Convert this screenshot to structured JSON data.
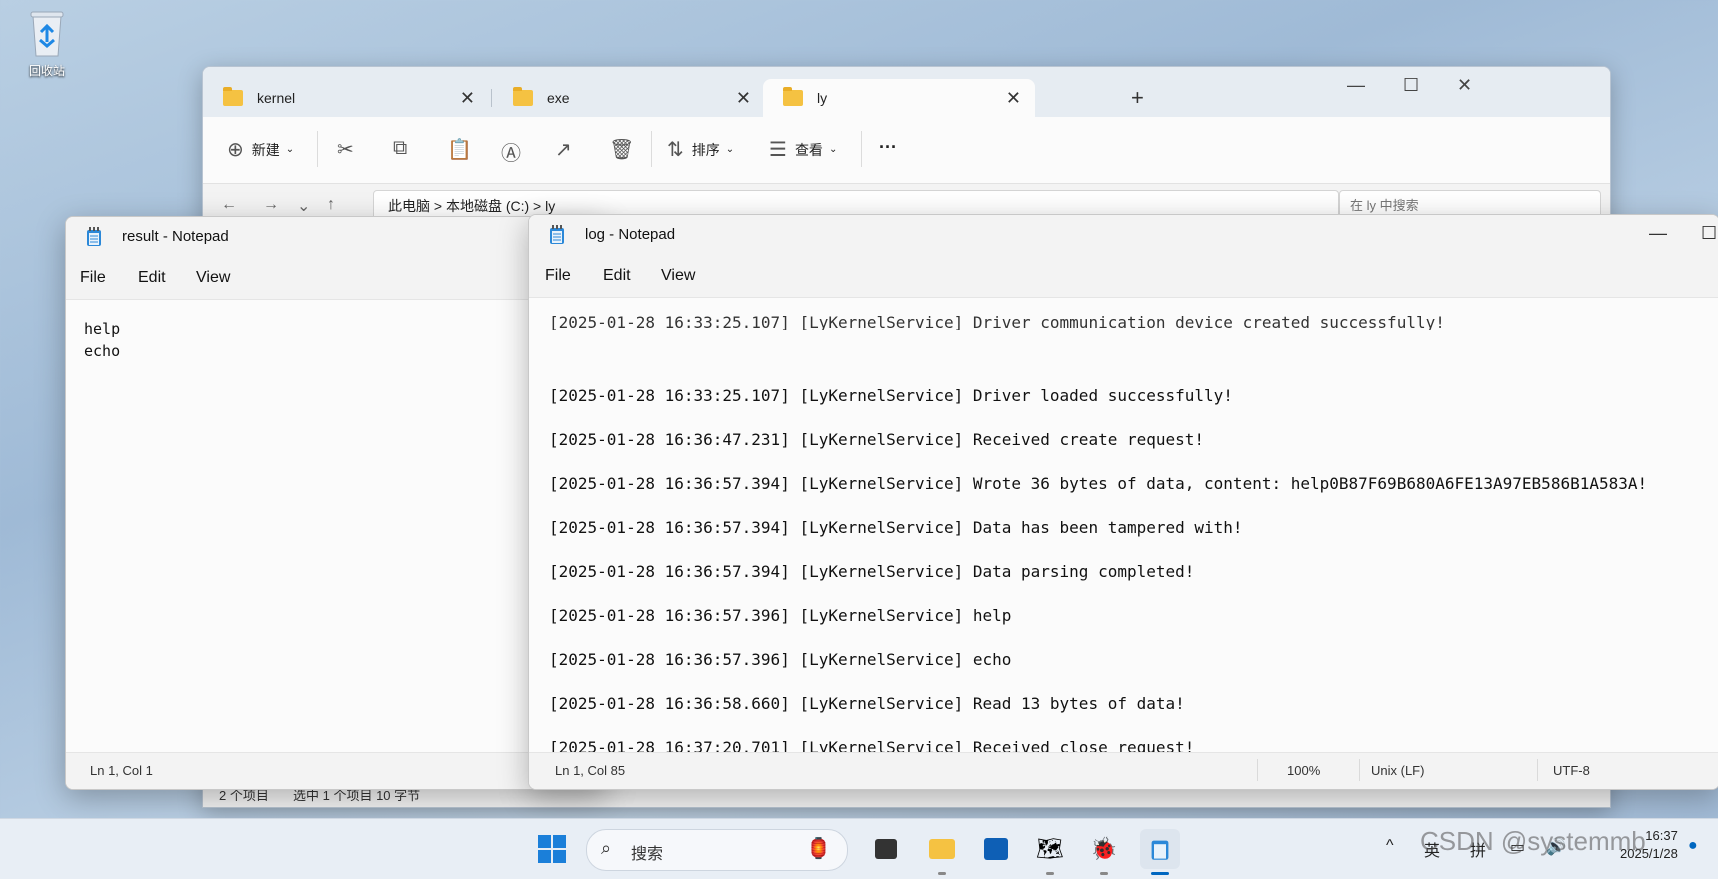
{
  "desktop": {
    "recycle_bin_label": "回收站"
  },
  "explorer": {
    "tabs": [
      {
        "label": "kernel"
      },
      {
        "label": "exe"
      },
      {
        "label": "ly"
      }
    ],
    "toolbar": {
      "new_label": "新建",
      "sort_label": "排序",
      "view_label": "查看",
      "more_label": "···"
    },
    "address": "此电脑 > 本地磁盘 (C:) > ly",
    "search_placeholder": "在 ly 中搜索",
    "status": {
      "count": "2 个项目",
      "selected": "选中 1 个项目  10 字节"
    }
  },
  "result_notepad": {
    "title": "result - Notepad",
    "menu": [
      "File",
      "Edit",
      "View"
    ],
    "content": "help\necho",
    "status_position": "Ln 1, Col 1"
  },
  "log_notepad": {
    "title": "log - Notepad",
    "menu": [
      "File",
      "Edit",
      "View"
    ],
    "partial_top_line": "[2025-01-28 16:33:25.107] [LyKernelService] Driver communication device created successfully!",
    "lines": [
      "[2025-01-28 16:33:25.107] [LyKernelService] Driver loaded successfully!",
      "[2025-01-28 16:36:47.231] [LyKernelService] Received create request!",
      "[2025-01-28 16:36:57.394] [LyKernelService] Wrote 36 bytes of data, content: help0B87F69B680A6FE13A97EB586B1A583A!",
      "[2025-01-28 16:36:57.394] [LyKernelService] Data has been tampered with!",
      "[2025-01-28 16:36:57.394] [LyKernelService] Data parsing completed!",
      "[2025-01-28 16:36:57.396] [LyKernelService] help",
      "[2025-01-28 16:36:57.396] [LyKernelService] echo",
      "[2025-01-28 16:36:58.660] [LyKernelService] Read 13 bytes of data!",
      "[2025-01-28 16:37:20.701] [LyKernelService] Received close request!"
    ],
    "status": {
      "position": "Ln 1, Col 85",
      "zoom": "100%",
      "line_ending": "Unix (LF)",
      "encoding": "UTF-8"
    }
  },
  "taskbar": {
    "search_label": "搜索",
    "ime_lang": "英",
    "ime_mode": "拼",
    "time": "16:37",
    "date": "2025/1/28"
  },
  "watermark": "CSDN @systemmb"
}
